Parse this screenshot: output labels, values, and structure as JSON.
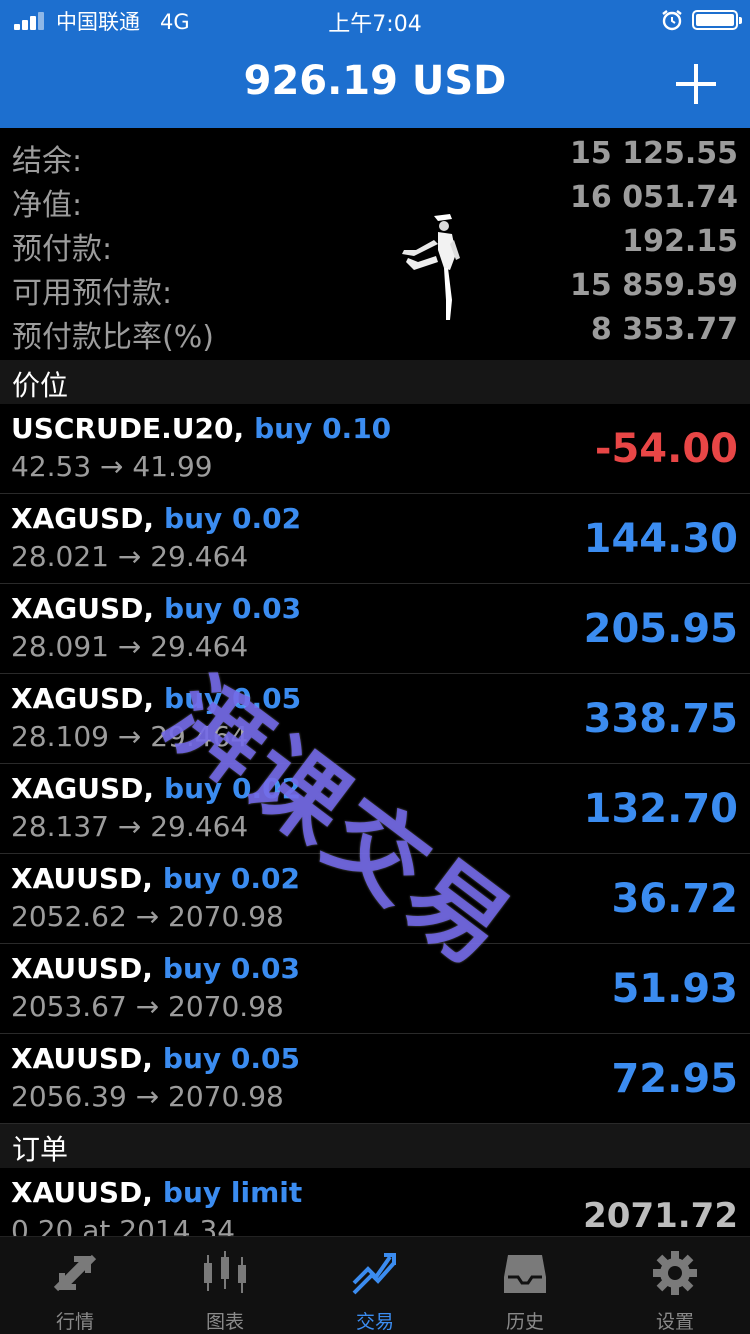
{
  "status_bar": {
    "carrier": "中国联通",
    "network": "4G",
    "time": "上午7:04"
  },
  "header": {
    "title": "926.19 USD",
    "add_icon": "plus-icon"
  },
  "account": [
    {
      "label": "结余:",
      "value": "15 125.55"
    },
    {
      "label": "净值:",
      "value": "16 051.74"
    },
    {
      "label": "预付款:",
      "value": "192.15"
    },
    {
      "label": "可用预付款:",
      "value": "15 859.59"
    },
    {
      "label": "预付款比率(%)",
      "value": "8 353.77"
    }
  ],
  "positions_header": "价位",
  "positions": [
    {
      "symbol": "USCRUDE.U20,",
      "type": "buy 0.10",
      "prices": "42.53 → 41.99",
      "profit": "-54.00"
    },
    {
      "symbol": "XAGUSD,",
      "type": "buy 0.02",
      "prices": "28.021 → 29.464",
      "profit": "144.30"
    },
    {
      "symbol": "XAGUSD,",
      "type": "buy 0.03",
      "prices": "28.091 → 29.464",
      "profit": "205.95"
    },
    {
      "symbol": "XAGUSD,",
      "type": "buy 0.05",
      "prices": "28.109 → 29.464",
      "profit": "338.75"
    },
    {
      "symbol": "XAGUSD,",
      "type": "buy 0.02",
      "prices": "28.137 → 29.464",
      "profit": "132.70"
    },
    {
      "symbol": "XAUUSD,",
      "type": "buy 0.02",
      "prices": "2052.62 → 2070.98",
      "profit": "36.72"
    },
    {
      "symbol": "XAUUSD,",
      "type": "buy 0.03",
      "prices": "2053.67 → 2070.98",
      "profit": "51.93"
    },
    {
      "symbol": "XAUUSD,",
      "type": "buy 0.05",
      "prices": "2056.39 → 2070.98",
      "profit": "72.95"
    }
  ],
  "orders_header": "订单",
  "orders": [
    {
      "symbol": "XAUUSD,",
      "type": "buy limit",
      "prices": "0.20 at 2014.34",
      "price": "2071.72"
    }
  ],
  "watermark": "湃课交易",
  "tabs": [
    {
      "label": "行情",
      "icon": "quotes-icon",
      "active": false
    },
    {
      "label": "图表",
      "icon": "chart-icon",
      "active": false
    },
    {
      "label": "交易",
      "icon": "trade-icon",
      "active": true
    },
    {
      "label": "历史",
      "icon": "history-icon",
      "active": false
    },
    {
      "label": "设置",
      "icon": "settings-icon",
      "active": false
    }
  ],
  "colors": {
    "header_bg": "#1d6fcf",
    "profit_positive": "#3b8cf0",
    "profit_negative": "#e84646",
    "tab_active": "#3b8cf0"
  }
}
